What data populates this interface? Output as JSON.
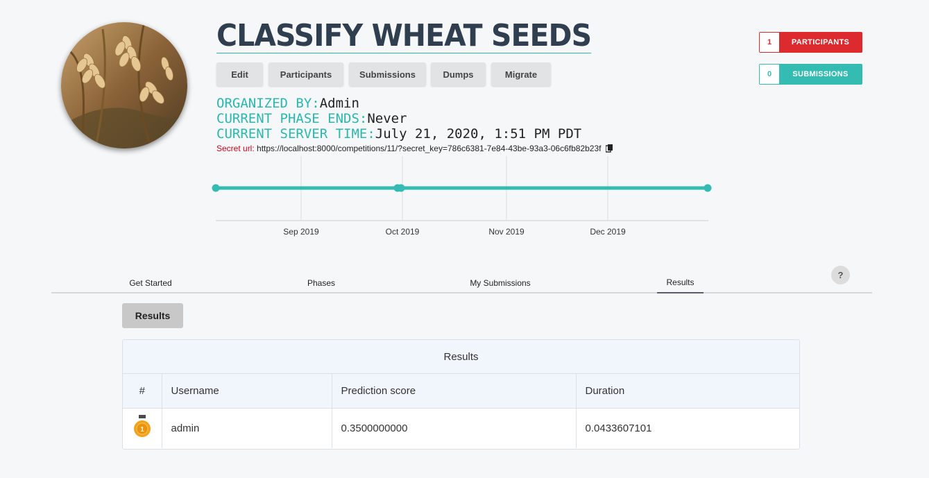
{
  "competition": {
    "title": "CLASSIFY WHEAT SEEDS"
  },
  "toolbar": {
    "edit": "Edit",
    "participants": "Participants",
    "submissions": "Submissions",
    "dumps": "Dumps",
    "migrate": "Migrate"
  },
  "info": {
    "organized_by_label": "ORGANIZED BY:",
    "organized_by": "Admin",
    "phase_ends_label": "CURRENT PHASE ENDS:",
    "phase_ends": "Never",
    "server_time_label": "CURRENT SERVER TIME:",
    "server_time": "July 21, 2020, 1:51 PM PDT",
    "secret_label": "Secret url:",
    "secret_url": "https://localhost:8000/competitions/11/?secret_key=786c6381-7e84-43be-93a3-06c6fb82b23f"
  },
  "stats": {
    "participants_count": "1",
    "participants_label": "PARTICIPANTS",
    "participants_color": "#dc2a2f",
    "submissions_count": "0",
    "submissions_label": "SUBMISSIONS",
    "submissions_color": "#35bcb2"
  },
  "timeline": {
    "ticks": [
      "Sep 2019",
      "Oct 2019",
      "Nov 2019",
      "Dec 2019"
    ],
    "line_color": "#35bcb2"
  },
  "tabs": [
    "Get Started",
    "Phases",
    "My Submissions",
    "Results"
  ],
  "active_tab": "Results",
  "help_label": "?",
  "results_button": "Results",
  "results": {
    "title": "Results",
    "columns": [
      "#",
      "Username",
      "Prediction score",
      "Duration"
    ],
    "rows": [
      {
        "rank_icon": "gold-medal-icon",
        "username": "admin",
        "score": "0.3500000000",
        "duration": "0.0433607101"
      }
    ]
  }
}
